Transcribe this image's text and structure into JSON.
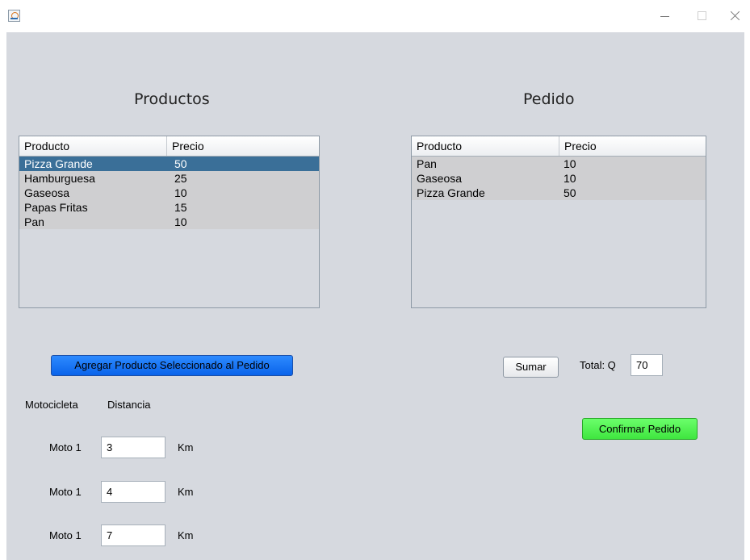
{
  "productos": {
    "title": "Productos",
    "columns": [
      "Producto",
      "Precio"
    ],
    "rows": [
      {
        "producto": "Pizza Grande",
        "precio": "50"
      },
      {
        "producto": "Hamburguesa",
        "precio": "25"
      },
      {
        "producto": "Gaseosa",
        "precio": "10"
      },
      {
        "producto": "Papas Fritas",
        "precio": "15"
      },
      {
        "producto": "Pan",
        "precio": "10"
      }
    ],
    "selected_row": "Pizza Grande"
  },
  "pedido": {
    "title": "Pedido",
    "columns": [
      "Producto",
      "Precio"
    ],
    "rows": [
      {
        "producto": "Pan",
        "precio": "10"
      },
      {
        "producto": "Gaseosa",
        "precio": "10"
      },
      {
        "producto": "Pizza Grande",
        "precio": "50"
      }
    ]
  },
  "buttons": {
    "agregar": "Agregar Producto Seleccionado al Pedido",
    "sumar": "Sumar",
    "confirmar": "Confirmar Pedido"
  },
  "total": {
    "label": "Total: Q",
    "value": "70"
  },
  "delivery": {
    "motocicleta_header": "Motocicleta",
    "distancia_header": "Distancia",
    "unit": "Km",
    "motos": [
      {
        "name": "Moto 1",
        "distance": "3"
      },
      {
        "name": "Moto 1",
        "distance": "4"
      },
      {
        "name": "Moto 1",
        "distance": "7"
      }
    ]
  },
  "colors": {
    "background": "#d6d9df",
    "selection": "#3a6f98",
    "row": "#cfcfd1",
    "agregar_button": "#1a75ff",
    "confirmar_button": "#4cff4c"
  }
}
